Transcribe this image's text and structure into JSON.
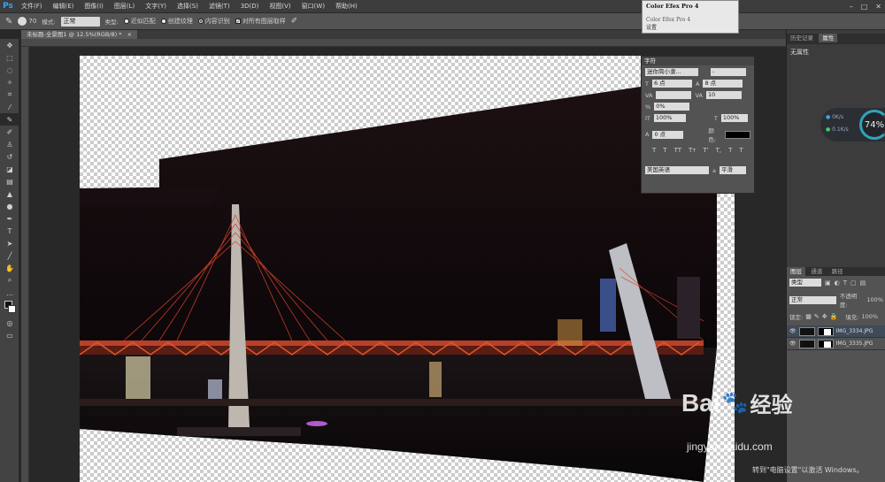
{
  "menubar": {
    "logo": "Ps",
    "items": [
      "文件(F)",
      "编辑(E)",
      "图像(I)",
      "图层(L)",
      "文字(Y)",
      "选择(S)",
      "滤镜(T)",
      "3D(D)",
      "视图(V)",
      "窗口(W)",
      "帮助(H)"
    ],
    "win_min": "–",
    "win_max": "□",
    "win_close": "✕"
  },
  "options": {
    "brush_size": "70",
    "mode_label": "模式:",
    "mode_value": "正常",
    "type_label": "类型:",
    "opt1": "近似匹配",
    "opt2": "创建纹理",
    "opt3": "内容识别",
    "sample_all": "对所有图层取样"
  },
  "document": {
    "tab_title": "未标题-全景图1 @ 12.5%(RGB/8) *",
    "tab_close": "×"
  },
  "plugin": {
    "title": "Color Efex Pro 4",
    "sub": "Color Efex Pro 4",
    "btn": "设置"
  },
  "char_panel": {
    "title": "字符",
    "font_family": "迷你简小隶...",
    "font_style": "-",
    "font_size": "6 点",
    "leading": "8 点",
    "tracking": "10",
    "scale": "0%",
    "vscale": "100%",
    "hscale": "100%",
    "baseline": "0 点",
    "color_label": "颜色:",
    "color_hex": "#000000",
    "styles": [
      "T",
      "T",
      "TT",
      "Tт",
      "T'",
      "T,",
      "T",
      "T"
    ],
    "language": "美国英语",
    "aa_label": "a",
    "aa_value": "平滑"
  },
  "dock": {
    "tabs_top": [
      "历史记录",
      "属性"
    ],
    "no_props": "无属性",
    "net_up": "0K/s",
    "net_down": "0.1K/s",
    "net_pct": "74%",
    "layers_tabs": [
      "图层",
      "通道",
      "路径"
    ],
    "kind_label": "类型",
    "blend": "正常",
    "opacity_label": "不透明度:",
    "opacity": "100%",
    "lock_label": "锁定:",
    "fill_label": "填充:",
    "fill": "100%",
    "layers": [
      {
        "name": "IMG_3334.JPG"
      },
      {
        "name": "IMG_3335.JPG"
      }
    ]
  },
  "watermark": {
    "brand_a": "Bai",
    "brand_b": "经验",
    "url": "jingyan.baidu.com",
    "activate": "转到\"电脑设置\"以激活 Windows。"
  }
}
